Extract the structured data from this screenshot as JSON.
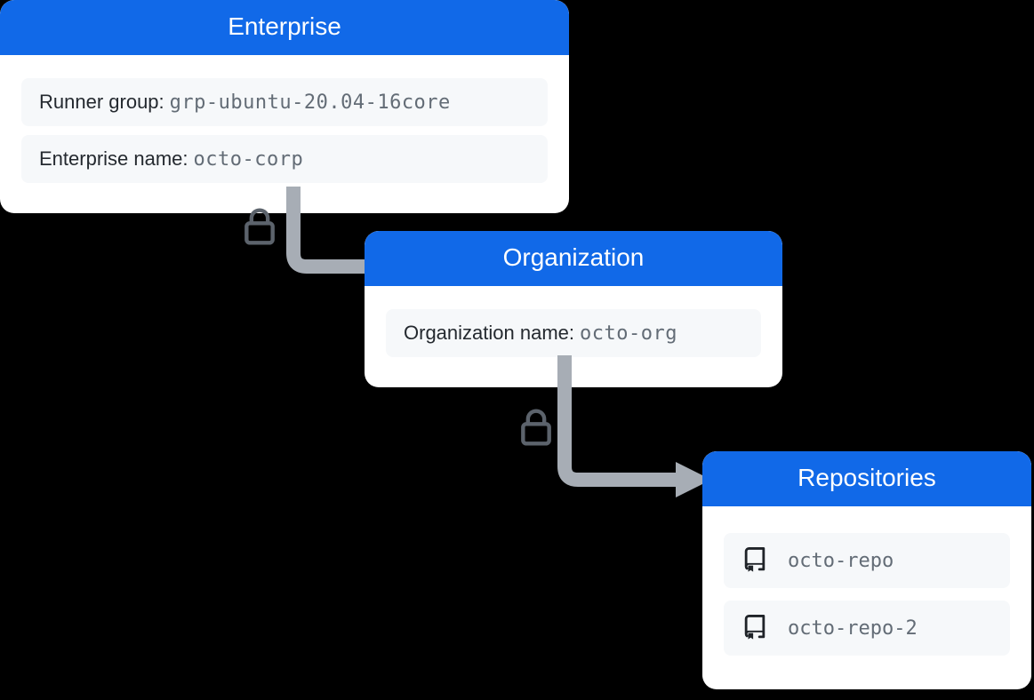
{
  "enterprise": {
    "title": "Enterprise",
    "runner_group_label": "Runner group:",
    "runner_group_value": "grp-ubuntu-20.04-16core",
    "name_label": "Enterprise name:",
    "name_value": "octo-corp"
  },
  "organization": {
    "title": "Organization",
    "name_label": "Organization name:",
    "name_value": "octo-org"
  },
  "repositories": {
    "title": "Repositories",
    "items": [
      "octo-repo",
      "octo-repo-2"
    ]
  }
}
